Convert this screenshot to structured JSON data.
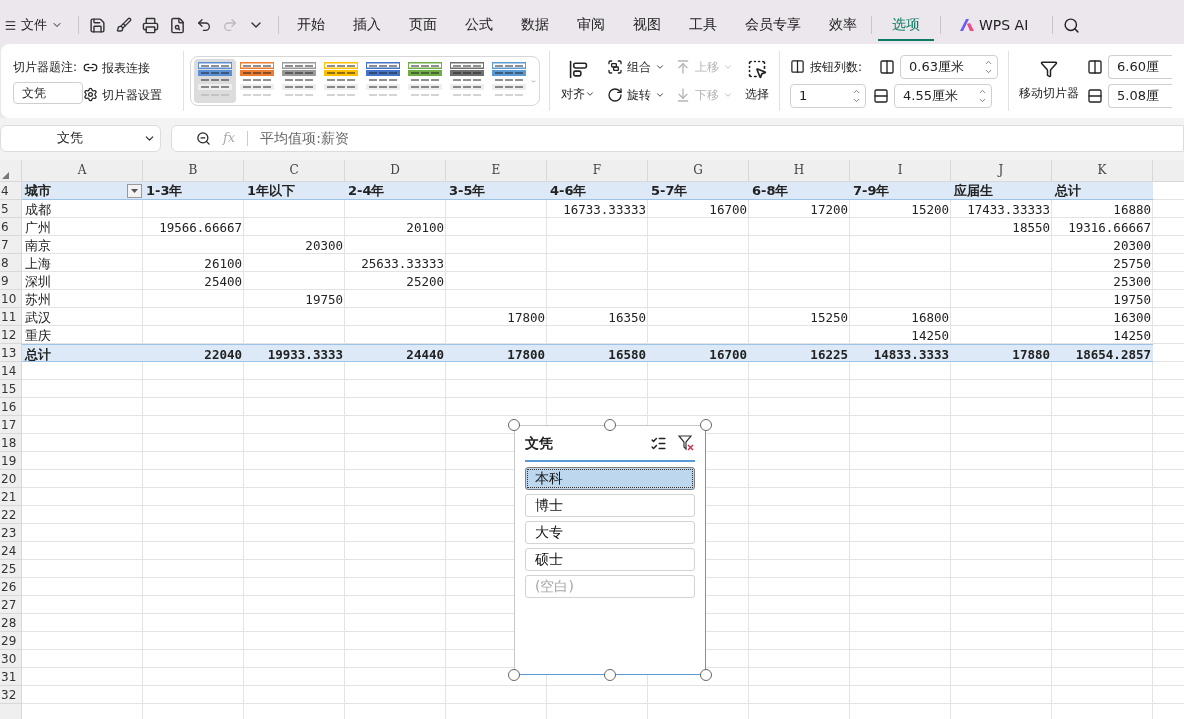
{
  "menu_bar": {
    "file_menu": "文件",
    "tabs": [
      {
        "label": "开始",
        "selected": false
      },
      {
        "label": "插入",
        "selected": false
      },
      {
        "label": "页面",
        "selected": false
      },
      {
        "label": "公式",
        "selected": false
      },
      {
        "label": "数据",
        "selected": false
      },
      {
        "label": "审阅",
        "selected": false
      },
      {
        "label": "视图",
        "selected": false
      },
      {
        "label": "工具",
        "selected": false
      },
      {
        "label": "会员专享",
        "selected": false
      },
      {
        "label": "效率",
        "selected": false
      },
      {
        "label": "选项",
        "selected": true
      }
    ],
    "ai_button": "WPS AI"
  },
  "ribbon": {
    "caption_label": "切片器题注:",
    "caption_value": "文凭",
    "report_connections": "报表连接",
    "slicer_settings": "切片器设置",
    "styles": [
      {
        "color": "#5b8fd6",
        "selected": true
      },
      {
        "color": "#ed7d31",
        "selected": false
      },
      {
        "color": "#9a9a9a",
        "selected": false
      },
      {
        "color": "#ffc000",
        "selected": false
      },
      {
        "color": "#4472c4",
        "selected": false
      },
      {
        "color": "#70ad47",
        "selected": false
      },
      {
        "color": "#6f6f6f",
        "selected": false
      },
      {
        "color": "#5b9bd5",
        "selected": false
      }
    ],
    "align": "对齐",
    "group": "组合",
    "rotate": "旋转",
    "move_up": {
      "label": "上移",
      "disabled": true
    },
    "move_down": {
      "label": "下移",
      "disabled": true
    },
    "select": "选择",
    "columns_label": "按钮列数:",
    "columns_value": "1",
    "button_height": "0.63厘米",
    "button_width": "4.55厘米",
    "move_slicer": "移动切片器",
    "slicer_height": "6.60厘",
    "slicer_width": "5.08厘"
  },
  "formula_bar": {
    "name_box": "文凭",
    "fx": "fx",
    "formula": "平均值项:薪资"
  },
  "sheet": {
    "columns": [
      "A",
      "B",
      "C",
      "D",
      "E",
      "F",
      "G",
      "H",
      "I",
      "J",
      "K"
    ],
    "first_row": "4",
    "header": [
      "城市",
      "1-3年",
      "1年以下",
      "2-4年",
      "3-5年",
      "4-6年",
      "5-7年",
      "6-8年",
      "7-9年",
      "应届生",
      "总计"
    ],
    "rows": [
      {
        "row": "5",
        "cells": [
          "成都",
          "",
          "",
          "",
          "",
          "16733.33333",
          "16700",
          "17200",
          "15200",
          "17433.33333",
          "16880"
        ]
      },
      {
        "row": "6",
        "cells": [
          "广州",
          "19566.66667",
          "",
          "20100",
          "",
          "",
          "",
          "",
          "",
          "18550",
          "19316.66667"
        ]
      },
      {
        "row": "7",
        "cells": [
          "南京",
          "",
          "20300",
          "",
          "",
          "",
          "",
          "",
          "",
          "",
          "20300"
        ]
      },
      {
        "row": "8",
        "cells": [
          "上海",
          "26100",
          "",
          "25633.33333",
          "",
          "",
          "",
          "",
          "",
          "",
          "25750"
        ]
      },
      {
        "row": "9",
        "cells": [
          "深圳",
          "25400",
          "",
          "25200",
          "",
          "",
          "",
          "",
          "",
          "",
          "25300"
        ]
      },
      {
        "row": "10",
        "cells": [
          "苏州",
          "",
          "19750",
          "",
          "",
          "",
          "",
          "",
          "",
          "",
          "19750"
        ]
      },
      {
        "row": "11",
        "cells": [
          "武汉",
          "",
          "",
          "",
          "17800",
          "16350",
          "",
          "15250",
          "16800",
          "",
          "16300"
        ]
      },
      {
        "row": "12",
        "cells": [
          "重庆",
          "",
          "",
          "",
          "",
          "",
          "",
          "",
          "14250",
          "",
          "14250"
        ]
      }
    ],
    "total": {
      "row": "13",
      "cells": [
        "总计",
        "22040",
        "19933.3333",
        "24440",
        "17800",
        "16580",
        "16700",
        "16225",
        "14833.3333",
        "17880",
        "18654.2857"
      ]
    },
    "empty_rows": [
      "14",
      "15",
      "16",
      "17",
      "18",
      "19",
      "20",
      "21",
      "22",
      "23",
      "24",
      "25",
      "26",
      "27",
      "28",
      "29",
      "30",
      "31",
      "32"
    ]
  },
  "slicer": {
    "title": "文凭",
    "items": [
      {
        "label": "本科",
        "selected": true,
        "has_data": true
      },
      {
        "label": "博士",
        "selected": false,
        "has_data": true
      },
      {
        "label": "大专",
        "selected": false,
        "has_data": true
      },
      {
        "label": "硕士",
        "selected": false,
        "has_data": true
      },
      {
        "label": "(空白)",
        "selected": false,
        "has_data": false
      }
    ]
  }
}
